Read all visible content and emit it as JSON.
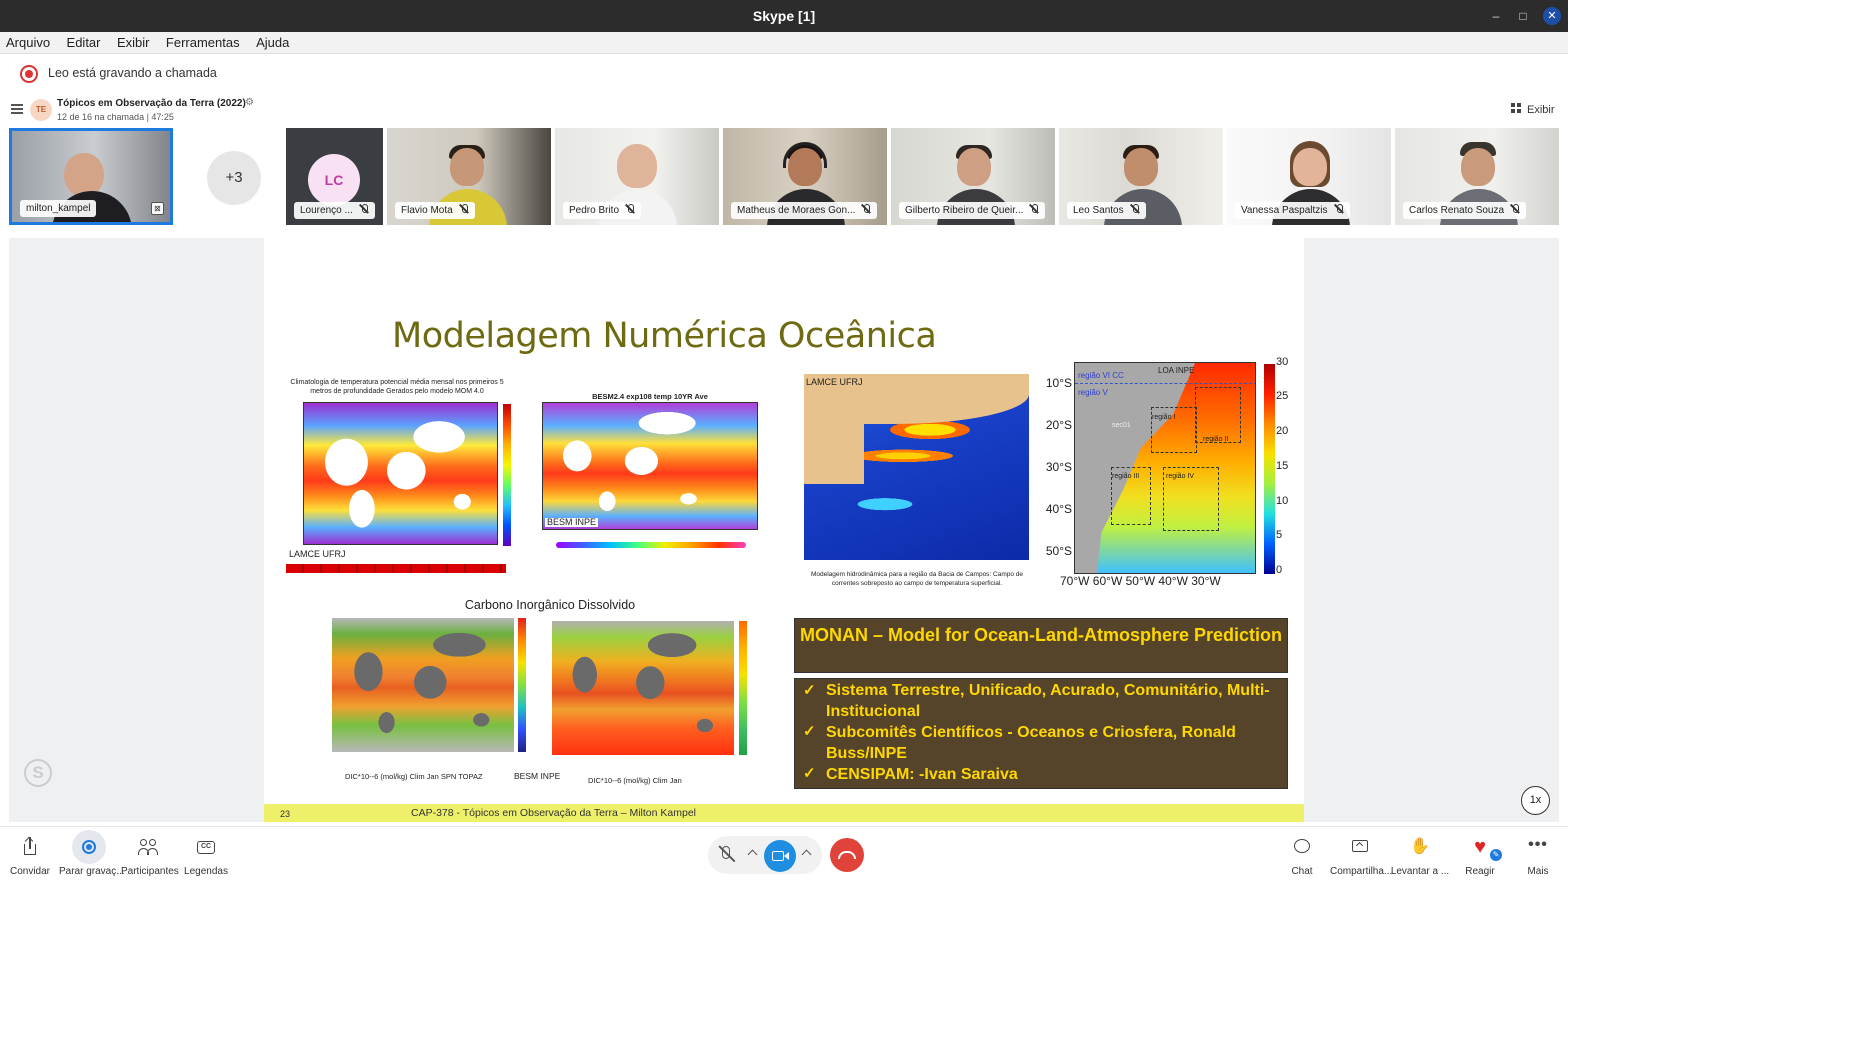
{
  "window": {
    "title": "Skype [1]",
    "minimize": "–",
    "maximize": "□",
    "close": "✕"
  },
  "menu": [
    "Arquivo",
    "Editar",
    "Exibir",
    "Ferramentas",
    "Ajuda"
  ],
  "recording": {
    "text": "Leo está gravando a chamada"
  },
  "call": {
    "avatar": "TE",
    "title": "Tópicos em Observação da Terra (2022)",
    "subtitle": "12 de 16 na chamada | 47:25",
    "view_label": "Exibir"
  },
  "participants": {
    "self": {
      "name": "milton_kampel"
    },
    "overflow": "+3",
    "tiles": [
      {
        "name": "Lourenço ...",
        "initials": "LC"
      },
      {
        "name": "Flavio Mota"
      },
      {
        "name": "Pedro Brito"
      },
      {
        "name": "Matheus de Moraes Gon..."
      },
      {
        "name": "Gilberto Ribeiro de Queir..."
      },
      {
        "name": "Leo Santos"
      },
      {
        "name": "Vanessa Paspaltzis"
      },
      {
        "name": "Carlos Renato Souza"
      }
    ]
  },
  "slide": {
    "title": "Modelagem Numérica Oceânica",
    "fig1_caption": "Climatologia de temperatura potencial média mensal nos primeiros 5 metros de profundidade Gerados pelo modelo MOM 4.0",
    "fig1_label": "LAMCE UFRJ",
    "fig2_caption": "BESM2.4 exp108 temp 10YR Ave",
    "fig2_label": "BESM INPE",
    "fig3_label": "LAMCE UFRJ",
    "fig3_caption": "Modelagem hidrodinâmica para a região da Bacia de Campos: Campo de correntes sobreposto ao campo de temperatura superficial.",
    "fig4": {
      "lat_labels": [
        "10°S",
        "20°S",
        "30°S",
        "40°S",
        "50°S"
      ],
      "lon_labels": "70°W 60°W 50°W 40°W 30°W",
      "scale": [
        "30",
        "25",
        "20",
        "15",
        "10",
        "5",
        "0"
      ],
      "regions": [
        "região VI CC",
        "região V",
        "LOA INPE",
        "região I",
        "região II",
        "região III",
        "região IV",
        "sec01"
      ]
    },
    "dic_title": "Carbono Inorgânico Dissolvido",
    "dic_caption1": "DIC*10--6 (mol/kg) Clim Jan SPN TOPAZ",
    "dic_caption2": "BESM INPE",
    "dic_caption3": "DIC*10--6 (mol/kg) Clim Jan",
    "monan_title": "MONAN – Model for Ocean-Land-Atmosphere Prediction",
    "bullets": [
      "Sistema Terrestre, Unificado, Acurado, Comunitário, Multi-Institucional",
      "Subcomitês Científicos  - Oceanos e Criosfera, Ronald Buss/INPE",
      "CENSIPAM: -Ivan Saraiva"
    ],
    "footer": "CAP-378 - Tópicos em Observação da Terra – Milton Kampel",
    "page": "23"
  },
  "playback_speed": "1x",
  "toolbar": {
    "invite": "Convidar",
    "stop_recording": "Parar gravaç...",
    "participants": "Participantes",
    "captions": "Legendas",
    "chat": "Chat",
    "share": "Compartilha...",
    "raise_hand": "Levantar a ...",
    "react": "Reagir",
    "more": "Mais"
  },
  "colors": {
    "accent": "#1f7ae0",
    "hangup": "#e0433a",
    "recording": "#dd3333",
    "slide_title": "#6e6a12",
    "monan_bg": "#55442a",
    "monan_text": "#ffd700"
  }
}
